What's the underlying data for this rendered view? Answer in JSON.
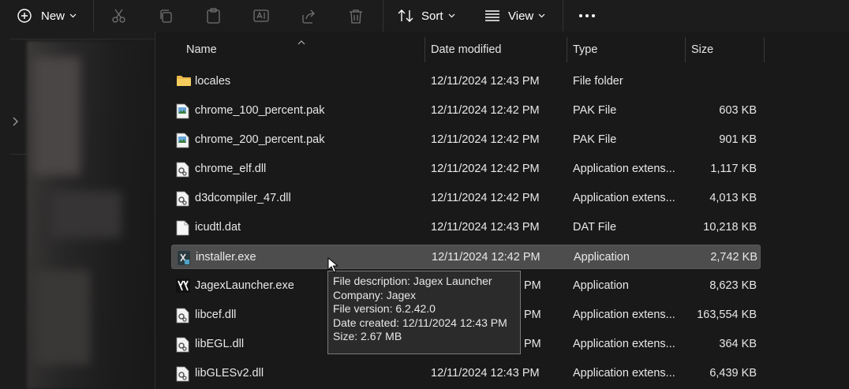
{
  "toolbar": {
    "new_label": "New",
    "sort_label": "Sort",
    "view_label": "View",
    "icons": [
      "plus-circle-icon",
      "cut-icon",
      "copy-icon",
      "paste-icon",
      "rename-icon",
      "share-icon",
      "delete-icon",
      "sort-icon",
      "view-icon",
      "more-icon"
    ]
  },
  "columns": {
    "name": "Name",
    "date_modified": "Date modified",
    "type": "Type",
    "size": "Size"
  },
  "files": [
    {
      "name": "locales",
      "date": "12/11/2024 12:43 PM",
      "type": "File folder",
      "size": "",
      "icon": "folder-icon"
    },
    {
      "name": "chrome_100_percent.pak",
      "date": "12/11/2024 12:42 PM",
      "type": "PAK File",
      "size": "603 KB",
      "icon": "pak-file-icon"
    },
    {
      "name": "chrome_200_percent.pak",
      "date": "12/11/2024 12:42 PM",
      "type": "PAK File",
      "size": "901 KB",
      "icon": "pak-file-icon"
    },
    {
      "name": "chrome_elf.dll",
      "date": "12/11/2024 12:42 PM",
      "type": "Application extens...",
      "size": "1,117 KB",
      "icon": "dll-file-icon"
    },
    {
      "name": "d3dcompiler_47.dll",
      "date": "12/11/2024 12:42 PM",
      "type": "Application extens...",
      "size": "4,013 KB",
      "icon": "dll-file-icon"
    },
    {
      "name": "icudtl.dat",
      "date": "12/11/2024 12:43 PM",
      "type": "DAT File",
      "size": "10,218 KB",
      "icon": "blank-file-icon"
    },
    {
      "name": "installer.exe",
      "date": "12/11/2024 12:42 PM",
      "type": "Application",
      "size": "2,742 KB",
      "icon": "installer-exe-icon"
    },
    {
      "name": "JagexLauncher.exe",
      "date": "PM",
      "type": "Application",
      "size": "8,623 KB",
      "icon": "jagex-logo-icon"
    },
    {
      "name": "libcef.dll",
      "date": "PM",
      "type": "Application extens...",
      "size": "163,554 KB",
      "icon": "dll-file-icon"
    },
    {
      "name": "libEGL.dll",
      "date": "PM",
      "type": "Application extens...",
      "size": "364 KB",
      "icon": "dll-file-icon"
    },
    {
      "name": "libGLESv2.dll",
      "date": "12/11/2024 12:43 PM",
      "type": "Application extens...",
      "size": "6,439 KB",
      "icon": "dll-file-icon"
    }
  ],
  "tooltip": {
    "description": "File description: Jagex Launcher",
    "company": "Company: Jagex",
    "version": "File version: 6.2.42.0",
    "created": "Date created: 12/11/2024 12:43 PM",
    "size": "Size: 2.67 MB"
  },
  "colors": {
    "background": "#191919",
    "toolbar": "#1c1c1c",
    "hover_row": "#4d4d4d",
    "folder": "#f2c14e",
    "text": "#e8e8e8"
  }
}
